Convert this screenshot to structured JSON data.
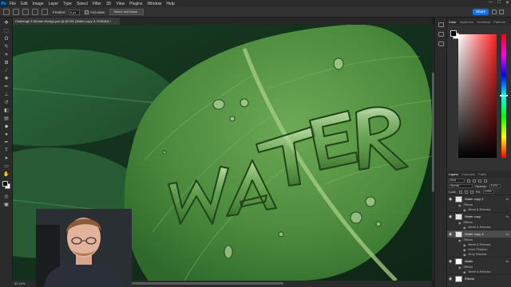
{
  "menubar": {
    "logo": "Ps",
    "items": [
      "File",
      "Edit",
      "Image",
      "Layer",
      "Type",
      "Select",
      "Filter",
      "3D",
      "View",
      "Plugins",
      "Window",
      "Help"
    ],
    "window_controls": [
      "—",
      "□",
      "✕"
    ]
  },
  "options": {
    "feather_label": "Feather:",
    "feather_value": "0 px",
    "antialias_label": "Anti-alias",
    "select_mask_label": "Select and Mask...",
    "share_label": "Share"
  },
  "document": {
    "tab_title": "Challenge 3 Stream Design.psd @ 82.6% (Water copy 3, RGB/8#) *",
    "zoom": "82.64%",
    "canvas_text": "WATER"
  },
  "panels": {
    "top_tabs": [
      "Color",
      "Swatches",
      "Gradients",
      "Patterns"
    ],
    "active_top_tab": "Color",
    "layer_tabs": [
      "Layers",
      "Channels",
      "Paths"
    ],
    "active_layer_tab": "Layers",
    "kind_label": "Kind",
    "blend_mode": "Normal",
    "opacity_label": "Opacity:",
    "opacity_value": "100%",
    "lock_label": "Lock:",
    "fill_label": "Fill:",
    "fill_value": "100%",
    "layers": [
      {
        "name": "Water copy 2",
        "effects_label": "Effects",
        "effects": [
          "Bevel & Emboss"
        ]
      },
      {
        "name": "Water copy",
        "effects_label": "Effects",
        "effects": [
          "Bevel & Emboss"
        ]
      },
      {
        "name": "Water copy 3",
        "selected": true,
        "effects_label": "Effects",
        "effects": [
          "Bevel & Emboss",
          "Inner Shadow",
          "Drop Shadow"
        ]
      },
      {
        "name": "Water",
        "effects_label": "Effects",
        "effects": [
          "Bevel & Emboss"
        ]
      },
      {
        "name": "Effects",
        "effects_label": "",
        "effects": []
      }
    ],
    "fx_label": "fx"
  },
  "colors": {
    "accent": "#1473e6",
    "leaf": "#4c8b3d",
    "panel_bg": "#323232"
  }
}
